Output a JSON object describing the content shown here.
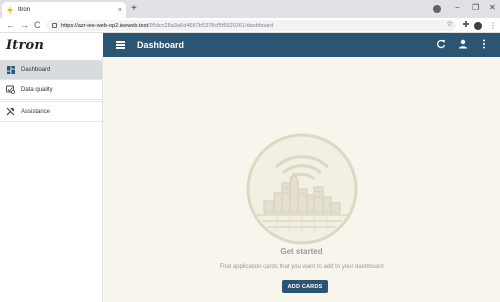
{
  "browser": {
    "tab_title": "Itron",
    "tab_close": "×",
    "new_tab": "+",
    "url_host": "https://azr-iee-web-op2.ieeweb.test",
    "url_path": "/95dcc28a3a6d4687b5378cf5f6520261/dashboard",
    "window_min": "−",
    "window_max": "❐",
    "window_close": "✕",
    "back": "←",
    "forward": "→",
    "reload": "C",
    "bookmark": "☆",
    "menu": "⋮"
  },
  "app": {
    "logo": "Itron",
    "header_title": "Dashboard",
    "accent_color": "#2c5573"
  },
  "sidebar": {
    "items": [
      {
        "label": "Dashboard",
        "icon": "dashboard-grid-icon",
        "active": true
      },
      {
        "label": "Data quality",
        "icon": "data-quality-icon",
        "active": false
      },
      {
        "label": "Assistance",
        "icon": "tools-icon",
        "active": false
      }
    ]
  },
  "main": {
    "empty_title": "Get started",
    "empty_text": "Find application cards that you want to add to your dashboard",
    "add_button": "ADD CARDS"
  }
}
